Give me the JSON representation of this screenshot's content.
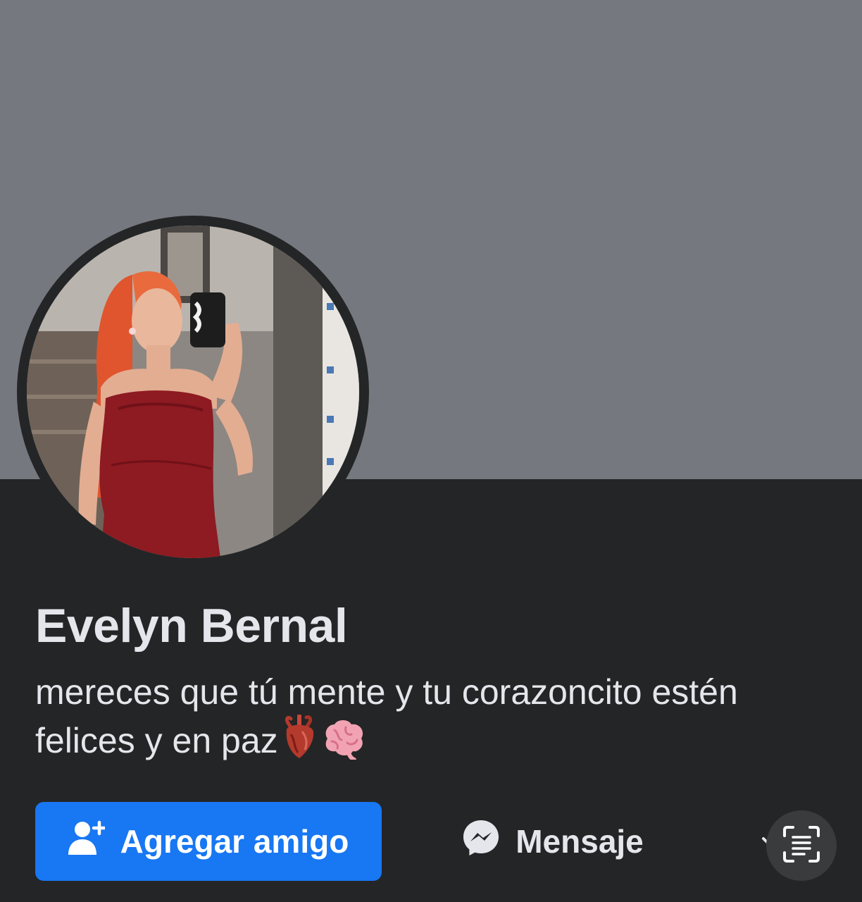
{
  "profile": {
    "name": "Evelyn Bernal",
    "bio_text": "mereces que tú mente y tu corazoncito estén felices y en paz",
    "bio_emojis": [
      "anatomical-heart-emoji",
      "brain-emoji"
    ]
  },
  "actions": {
    "add_friend_label": "Agregar amigo",
    "message_label": "Mensaje"
  },
  "icons": {
    "add_friend": "person-add-icon",
    "message": "messenger-icon",
    "more": "chevron-down-icon",
    "scan": "text-scan-icon"
  },
  "colors": {
    "cover": "#76787f",
    "background": "#242526",
    "primary_button": "#1877f2",
    "text": "#e4e6eb"
  }
}
